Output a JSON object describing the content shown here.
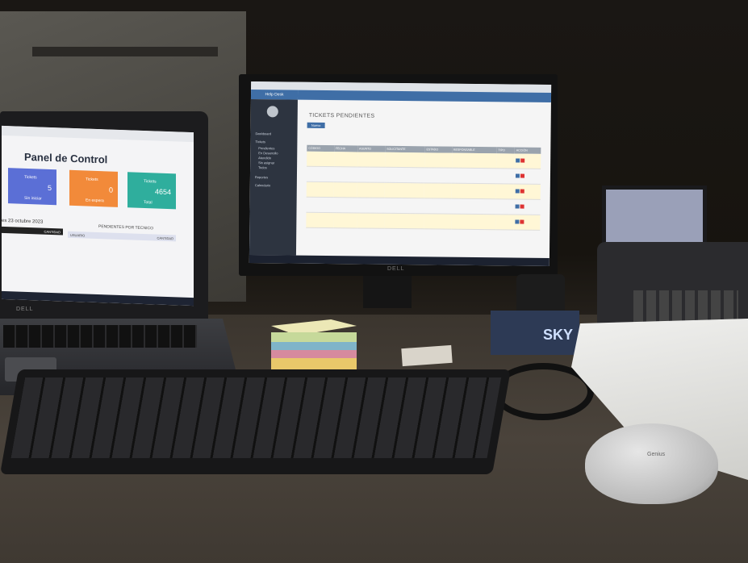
{
  "laptop": {
    "title": "Panel de Control",
    "cards": [
      {
        "label": "Tickets",
        "value": "5",
        "sub": "Sin iniciar",
        "color": "#5b6fd6"
      },
      {
        "label": "Tickets",
        "value": "0",
        "sub": "En espera",
        "color": "#f28a3a"
      },
      {
        "label": "Tickets",
        "value": "4654",
        "sub": "Total",
        "color": "#2fae9d"
      }
    ],
    "date_label": "es 23 octubre 2023",
    "table_header_left": "CANTIDAD",
    "list_title": "PENDIENTES POR TECNICO",
    "list_col_1": "USUARIO",
    "list_col_2": "CANTIDAD",
    "brand": "DELL"
  },
  "monitor": {
    "app_brand": "Help Desk",
    "page_title": "TICKETS PENDIENTES",
    "new_button": "Nuevo",
    "nav_items": [
      "Dashboard",
      "Tickets",
      "Pendientes",
      "En Desarrollo",
      "Atendido",
      "Sin asignar",
      "Todos",
      "Reportes",
      "Calendario"
    ],
    "columns": [
      "CÓDIGO",
      "FECHA",
      "ASUNTO",
      "SOLICITANTE",
      "ESTADO",
      "RESPONSABLE",
      "TIPO",
      "ACCIÓN"
    ],
    "brand": "DELL"
  },
  "misc": {
    "sky_label": "SKY",
    "mouse_brand": "Genius"
  },
  "colors": {
    "helpdesk_blue": "#3f6ea6",
    "sidebar": "#2d3440",
    "highlight_row": "#fff7d6"
  }
}
